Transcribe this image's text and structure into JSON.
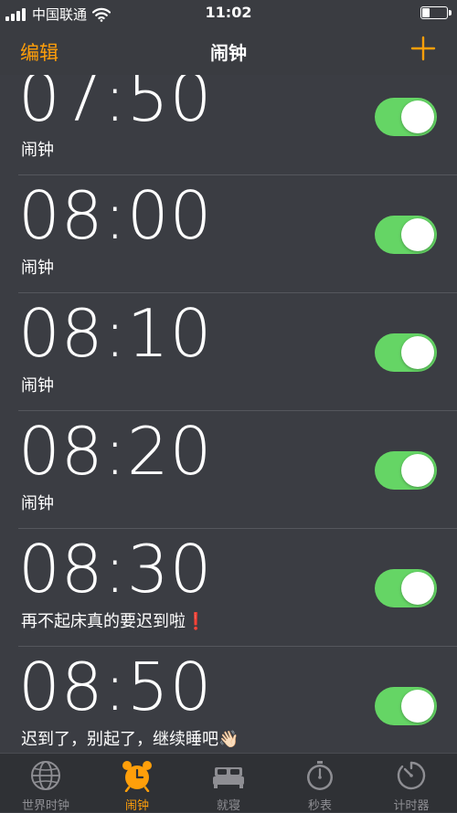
{
  "status_bar": {
    "carrier": "中国联通",
    "time": "11:02"
  },
  "nav": {
    "edit_label": "编辑",
    "title": "闹钟",
    "add_icon": "plus-icon"
  },
  "alarms": [
    {
      "time": "07:50",
      "label": "闹钟",
      "enabled": true
    },
    {
      "time": "08:00",
      "label": "闹钟",
      "enabled": true
    },
    {
      "time": "08:10",
      "label": "闹钟",
      "enabled": true
    },
    {
      "time": "08:20",
      "label": "闹钟",
      "enabled": true
    },
    {
      "time": "08:30",
      "label": "再不起床真的要迟到啦❗",
      "enabled": true
    },
    {
      "time": "08:50",
      "label": "迟到了，别起了，继续睡吧👋🏻",
      "enabled": true
    }
  ],
  "tabs": [
    {
      "label": "世界时钟",
      "icon": "globe-icon",
      "active": false
    },
    {
      "label": "闹钟",
      "icon": "alarm-clock-icon",
      "active": true
    },
    {
      "label": "就寝",
      "icon": "bed-icon",
      "active": false
    },
    {
      "label": "秒表",
      "icon": "stopwatch-icon",
      "active": false
    },
    {
      "label": "计时器",
      "icon": "timer-icon",
      "active": false
    }
  ],
  "colors": {
    "accent": "#ff9f0a",
    "toggle_on": "#65d565",
    "background": "#3b3d43",
    "tab_inactive": "#8e8e93"
  }
}
